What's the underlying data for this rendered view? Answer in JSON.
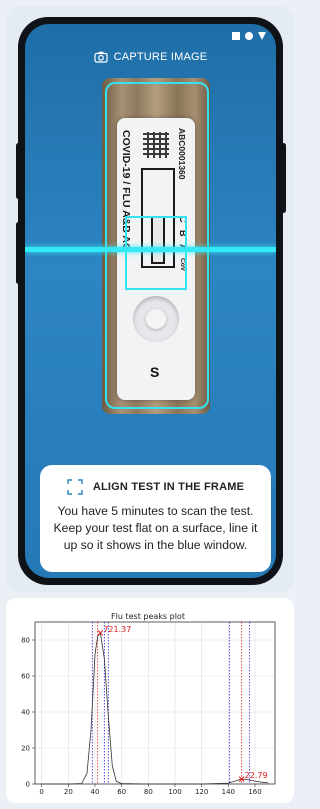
{
  "status_bar": {
    "icons": [
      "square-icon",
      "circle-icon",
      "triangle-icon"
    ]
  },
  "capture": {
    "label": "CAPTURE IMAGE",
    "icon": "camera-icon"
  },
  "test_strip": {
    "vertical_text": "COVID-19 / FLU A&B AG",
    "code": "ABC0001360",
    "markers": [
      "C",
      "B",
      "A",
      "CoV"
    ],
    "sample_label": "S"
  },
  "info_card": {
    "icon": "frame-corners-icon",
    "title": "ALIGN TEST IN THE FRAME",
    "body": "You have 5 minutes to scan the test. Keep your test flat on a surface, line it up so it shows in the blue window."
  },
  "colors": {
    "accent": "#33e3ef",
    "screen_blue": "#2479b6",
    "peak_marker": "#e31a1c"
  },
  "chart_data": {
    "type": "line",
    "title": "Flu test peaks plot",
    "xlim": [
      -5,
      175
    ],
    "ylim": [
      0,
      90
    ],
    "x_ticks": [
      0,
      20,
      40,
      60,
      80,
      100,
      120,
      140,
      160
    ],
    "y_ticks": [
      0,
      20,
      40,
      60,
      80
    ],
    "grid": true,
    "series": [
      {
        "x": [
          0,
          20,
          30,
          34,
          37,
          40,
          42,
          44,
          47,
          50,
          53,
          56,
          60,
          80,
          100,
          120,
          140,
          145,
          148,
          150,
          153,
          157,
          160,
          165,
          170
        ],
        "values": [
          0,
          0,
          0.3,
          6,
          30,
          72,
          82,
          84,
          70,
          38,
          10,
          1.5,
          0.2,
          0,
          0,
          0,
          0.5,
          1.6,
          2.4,
          2.7,
          2.6,
          2.0,
          1.6,
          1.0,
          0.6
        ]
      }
    ],
    "peaks": [
      {
        "x": 44,
        "y": 84,
        "label": "721.37"
      },
      {
        "x": 150,
        "y": 2.7,
        "label": "22.79"
      }
    ],
    "vlines_red": [
      42,
      150
    ],
    "vlines_blue": [
      38,
      47,
      50,
      141,
      156
    ]
  }
}
